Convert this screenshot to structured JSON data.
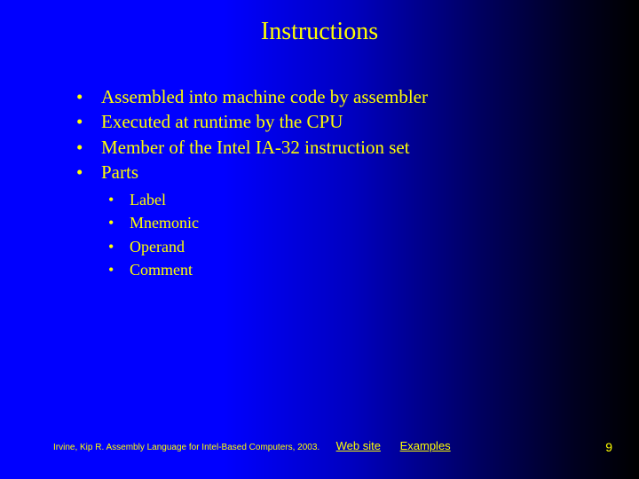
{
  "title": "Instructions",
  "bullets": [
    {
      "text": "Assembled into machine code by assembler"
    },
    {
      "text": "Executed at runtime by the CPU"
    },
    {
      "text": "Member of the Intel IA-32 instruction set"
    },
    {
      "text": "Parts",
      "children": [
        {
          "text": "Label"
        },
        {
          "text": "Mnemonic"
        },
        {
          "text": "Operand"
        },
        {
          "text": "Comment"
        }
      ]
    }
  ],
  "footer": {
    "credit": "Irvine, Kip R. Assembly Language for Intel-Based Computers, 2003.",
    "links": [
      {
        "label": "Web site"
      },
      {
        "label": "Examples"
      }
    ]
  },
  "page_number": "9"
}
